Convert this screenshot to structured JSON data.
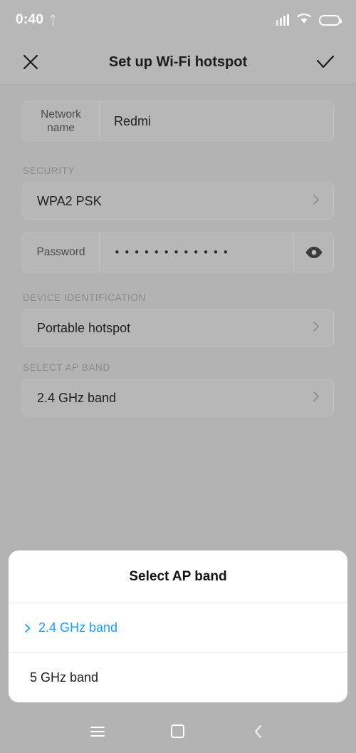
{
  "status_bar": {
    "time": "0:40",
    "bluetooth_icon": "bluetooth-icon",
    "signal_icon": "cellular-signal-icon",
    "wifi_icon": "wifi-icon",
    "battery_icon": "battery-icon"
  },
  "app_bar": {
    "close_icon": "close-icon",
    "title": "Set up Wi-Fi hotspot",
    "confirm_icon": "checkmark-icon"
  },
  "form": {
    "network_name": {
      "label": "Network name",
      "value": "Redmi"
    },
    "security_section": {
      "header": "SECURITY",
      "security_type": "WPA2 PSK",
      "password_label": "Password",
      "password_masked": "••••••••••••",
      "password_char_count": 12,
      "reveal_icon": "eye-icon",
      "chevron_icon": "chevron-right-icon"
    },
    "device_identification_section": {
      "header": "DEVICE IDENTIFICATION",
      "value": "Portable hotspot",
      "chevron_icon": "chevron-right-icon"
    },
    "ap_band_section": {
      "header": "SELECT AP BAND",
      "value": "2.4 GHz band",
      "chevron_icon": "chevron-right-icon"
    }
  },
  "dialog": {
    "title": "Select AP band",
    "accent_color": "#1e9bf0",
    "options": [
      {
        "label": "2.4 GHz band",
        "selected": true
      },
      {
        "label": "5 GHz band",
        "selected": false
      }
    ]
  },
  "nav_bar": {
    "menu_icon": "menu-icon",
    "home_icon": "home-icon",
    "back_icon": "back-icon"
  }
}
